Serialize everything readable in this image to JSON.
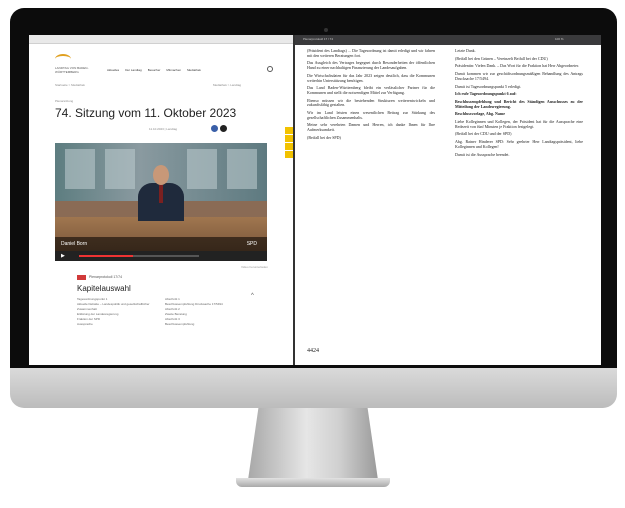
{
  "left_window": {
    "logo_text": "LANDTAG VON BADEN-WÜRTTEMBERG",
    "nav": [
      "Aktuelles",
      "Der Landtag",
      "Besucher",
      "Mitmachen",
      "Mediathek"
    ],
    "breadcrumb": "Startseite > Mediathek",
    "breadcrumb_right": "Mediathek > Landtag",
    "meta_small": "Plenarsitzung",
    "title": "74. Sitzung vom 11. Oktober 2023",
    "dates": "11.10.2023 | Landtag",
    "video": {
      "speaker_name": "Daniel Born",
      "party": "SPD",
      "progress": 0.45,
      "play_icon": "play-icon"
    },
    "below_video": "Video herunterladen",
    "badge_text": "Plenarprotokoll 17/74",
    "chapter_heading": "Kapitelauswahl",
    "chapters_left": [
      "Tagesordnungspunkt 1",
      "Aktuelle Debatte – Landespolitik und gesellschaftlicher Zusammenhalt",
      "Erklärung der Landesregierung",
      "Fraktion der SPD",
      "Aussprache"
    ],
    "chapters_right": [
      "Abschnitt 1",
      "Beschlussempfehlung Drucksache 17/5494",
      "Abschnitt 2",
      "Zweite Beratung",
      "Abschnitt 3",
      "Beschlussempfehlung"
    ]
  },
  "pdf_window": {
    "toolbar_left": "Plenarprotokoll 17 / 74",
    "toolbar_right": "100 %",
    "column1": [
      "(Präsident des Landtags) ... Die Tagesordnung ist damit erledigt und wir fahren mit den weiteren Beratungen fort.",
      "Das Ausgleich des Vertrages begegnet durch Besonderheiten der öffentlichen Hand zu einer nachhaltigen Finanzierung der Landesaufgaben.",
      "Die Wirtschaftsdaten für das Jahr 2023 zeigen deutlich, dass die Kommunen weiterhin Unterstützung benötigen.",
      "Das Land Baden-Württemberg bleibt ein verlässlicher Partner für die Kommunen und stellt die notwendigen Mittel zur Verfügung.",
      "Ebenso müssen wir die bestehenden Strukturen weiterentwickeln und zukunftsfähig gestalten.",
      "Wir im Land leisten einen wesentlichen Beitrag zur Stärkung des gesellschaftlichen Zusammenhalts.",
      "Meine sehr verehrten Damen und Herren, ich danke Ihnen für Ihre Aufmerksamkeit.",
      "(Beifall bei der SPD)"
    ],
    "column2": [
      "Letzte Dank.",
      "(Beifall bei den Grünen – Vereinzelt Beifall bei der CDU)",
      "Präsidentin: Vielen Dank. – Das Wort für die Fraktion hat Herr Abgeordneter.",
      "Damit kommen wir zur geschäftsordnungsmäßigen Behandlung des Antrags Drucksache 17/5494.",
      "Damit ist Tagesordnungspunkt 5 erledigt.",
      "Ich rufe Tagesordnungspunkt 6 auf:",
      "Beschlussempfehlung und Bericht des Ständigen Ausschusses zu der Mitteilung der Landesregierung.",
      "Beschlussvorlage, Abg. Name",
      "Liebe Kolleginnen und Kollegen, der Präsident hat für die Aussprache eine Redezeit von fünf Minuten je Fraktion festgelegt.",
      "(Beifall bei der CDU und der SPD)",
      "Abg. Rainer Hinderer SPD: Sehr geehrter Herr Landtagspräsident, liebe Kolleginnen und Kollegen!",
      "Damit ist die Aussprache beendet."
    ],
    "page_number": "4424"
  }
}
